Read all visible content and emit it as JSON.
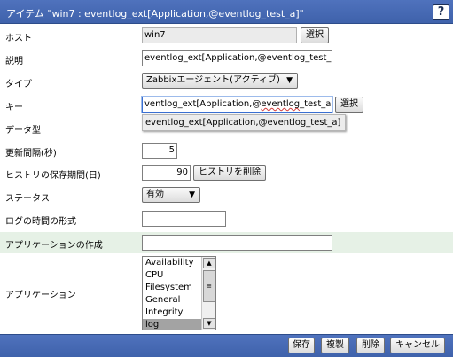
{
  "header": {
    "title": "アイテム \"win7 : eventlog_ext[Application,@eventlog_test_a]\"",
    "help_label": "?"
  },
  "form": {
    "host": {
      "label": "ホスト",
      "value": "win7",
      "button": "選択"
    },
    "description": {
      "label": "説明",
      "value": "eventlog_ext[Application,@eventlog_test_a"
    },
    "type": {
      "label": "タイプ",
      "value": "Zabbixエージェント(アクティブ)"
    },
    "key": {
      "label": "キー",
      "value": "eventlog_ext[Application,@eventlog_test_a]",
      "value_visible_prefix": "ventlog_ext[Application,@",
      "value_visible_underlined": "eventlog",
      "value_visible_suffix": "_test_a]",
      "button": "選択",
      "autocomplete": "eventlog_ext[Application,@eventlog_test_a]"
    },
    "data_type": {
      "label": "データ型"
    },
    "interval": {
      "label": "更新間隔(秒)",
      "value": "5"
    },
    "history": {
      "label": "ヒストリの保存期間(日)",
      "value": "90",
      "button": "ヒストリを削除"
    },
    "status": {
      "label": "ステータス",
      "value": "有効"
    },
    "log_time_format": {
      "label": "ログの時間の形式",
      "value": ""
    },
    "new_application": {
      "label": "アプリケーションの作成",
      "value": ""
    },
    "applications": {
      "label": "アプリケーション",
      "items": [
        "Availability",
        "CPU",
        "Filesystem",
        "General",
        "Integrity",
        "log"
      ],
      "selected_index": 5
    }
  },
  "footer": {
    "save": "保存",
    "clone": "複製",
    "delete": "削除",
    "cancel": "キャンセル"
  },
  "colors": {
    "header_bg": "#4565b3",
    "highlight_row": "#e6f1e6",
    "selected_item": "#a3a3a3"
  }
}
